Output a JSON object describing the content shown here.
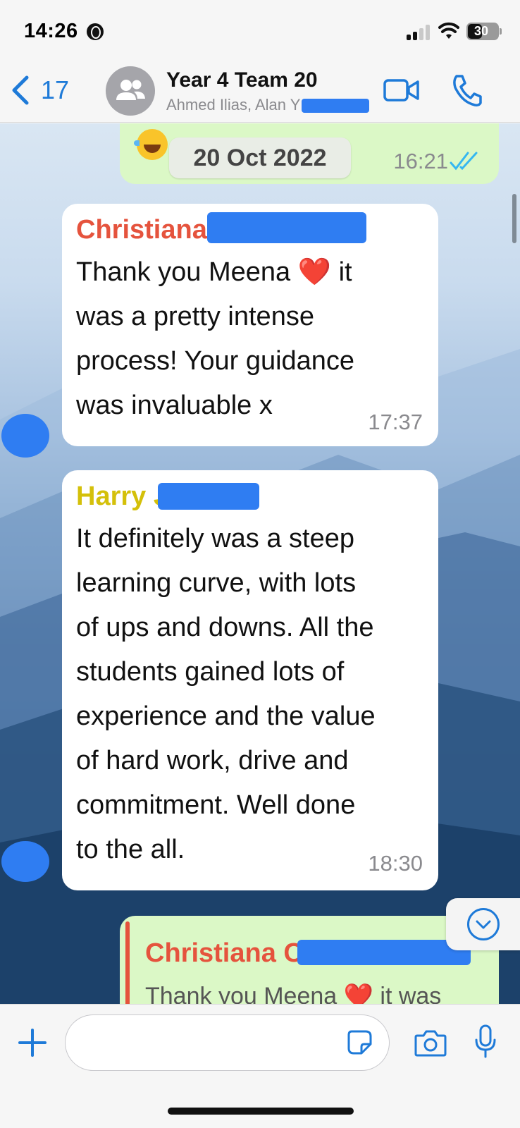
{
  "status_bar": {
    "time": "14:26",
    "battery": "30"
  },
  "header": {
    "back_count": "17",
    "title": "Year 4 Team 20",
    "subtitle": "Ahmed Ilias, Alan Y"
  },
  "messages": [
    {
      "type": "outgoing",
      "date_label": "20 Oct 2022",
      "time": "16:21",
      "status": "read"
    },
    {
      "type": "incoming",
      "sender": "Christiana C",
      "sender_color": "#e5533d",
      "lines": [
        "Thank you Meena ❤️ it",
        "was a pretty intense",
        "process! Your guidance",
        "was invaluable x"
      ],
      "time": "17:37"
    },
    {
      "type": "incoming",
      "sender": "Harry J",
      "sender_color": "#d4c00a",
      "lines": [
        "It definitely was a steep",
        "learning curve, with lots",
        "of ups and downs. All the",
        "students gained lots of",
        "experience and the value",
        "of hard work, drive and",
        "commitment. Well done",
        "to the  all."
      ],
      "time": "18:30"
    },
    {
      "type": "outgoing-reply",
      "quoted_sender": "Christiana C",
      "quoted_text": "Thank you Meena ❤️ it was"
    }
  ],
  "input": {
    "placeholder": ""
  },
  "icons": {
    "back": "chevron-left-icon",
    "avatar": "group-icon",
    "video": "video-camera-icon",
    "call": "phone-icon",
    "scroll_down": "chevron-down-icon",
    "attach": "plus-icon",
    "sticker": "sticker-icon",
    "camera": "camera-icon",
    "mic": "microphone-icon"
  },
  "colors": {
    "accent": "#1e7ad8",
    "outgoing_bubble": "#dbf8c6",
    "incoming_bubble": "#ffffff",
    "read_ticks": "#34b7f1"
  }
}
